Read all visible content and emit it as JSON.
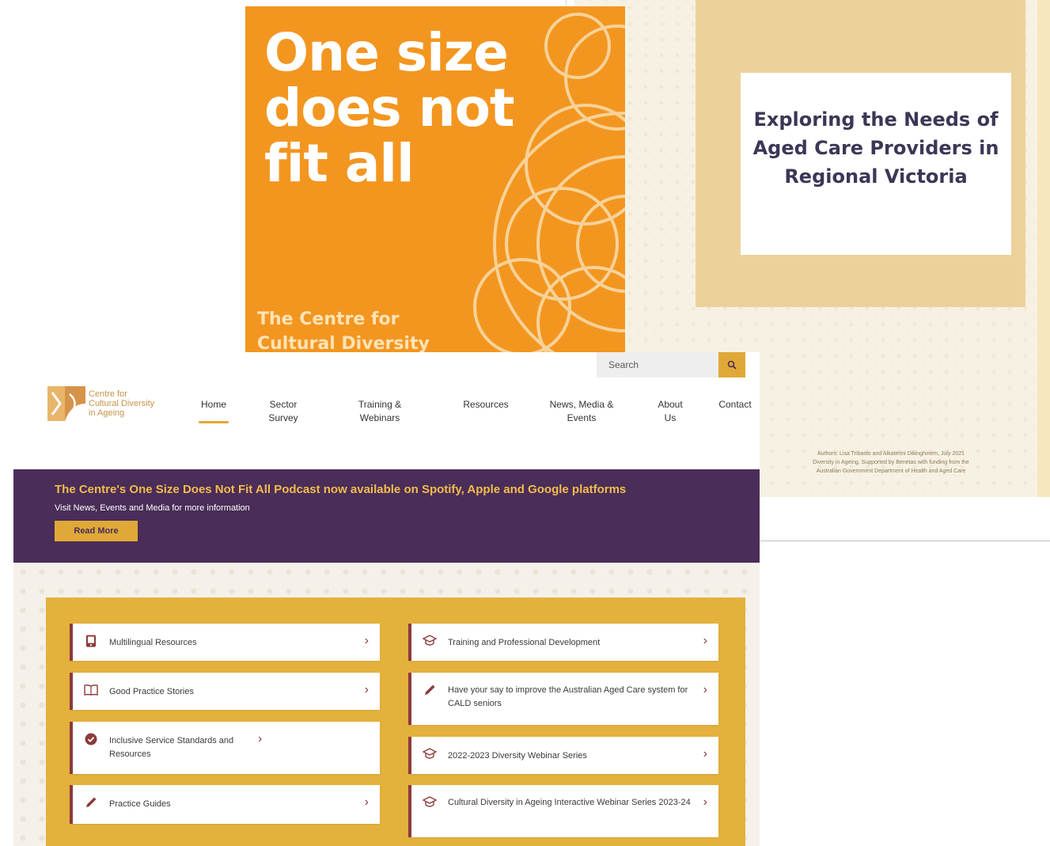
{
  "report": {
    "title": "Exploring the Needs of Aged Care Providers in Regional Victoria",
    "credits": [
      "Authors: Lisa Tribasto and Alkaterini Dikinghinem, July 2021",
      "Diversity in Ageing, Supported by Benetas with funding from the",
      "Australian Government Department of Health and Aged Care"
    ]
  },
  "podcast": {
    "title_lines": [
      "One size",
      "does not",
      "fit all"
    ],
    "subtitle_lines": [
      "The Centre for",
      "Cultural Diversity"
    ]
  },
  "site": {
    "search": {
      "placeholder": "Search"
    },
    "logo": {
      "lines": [
        "Centre for",
        "Cultural Diversity",
        "in Ageing"
      ]
    },
    "nav": [
      {
        "label": "Home",
        "active": true
      },
      {
        "label": "Sector Survey"
      },
      {
        "label": "Training & Webinars"
      },
      {
        "label": "Resources"
      },
      {
        "label": "News, Media & Events"
      },
      {
        "label": "About Us"
      },
      {
        "label": "Contact"
      }
    ],
    "banner": {
      "title": "The Centre's One Size Does Not Fit All Podcast now available on Spotify, Apple and Google platforms",
      "subtitle": "Visit News, Events and Media for more information",
      "button": "Read More"
    },
    "cards_left": [
      {
        "label": "Multilingual Resources",
        "icon": "phone-icon"
      },
      {
        "label": "Good Practice Stories",
        "icon": "book-icon"
      },
      {
        "label": "Inclusive Service Standards and Resources",
        "icon": "check-badge-icon"
      },
      {
        "label": "Practice Guides",
        "icon": "pencil-icon"
      }
    ],
    "cards_right": [
      {
        "label": "Training and Professional Development",
        "icon": "graduation-icon"
      },
      {
        "label": "Have your say to improve the Australian Aged Care system for CALD seniors",
        "icon": "pencil-icon"
      },
      {
        "label": "2022-2023 Diversity Webinar Series",
        "icon": "graduation-icon"
      },
      {
        "label": "Cultural Diversity in Ageing Interactive Webinar Series 2023-24",
        "icon": "graduation-icon"
      }
    ]
  },
  "colors": {
    "purple": "#4a2d58",
    "gold": "#e4b13d",
    "orange": "#f39620",
    "maroon": "#8c3b3b"
  }
}
